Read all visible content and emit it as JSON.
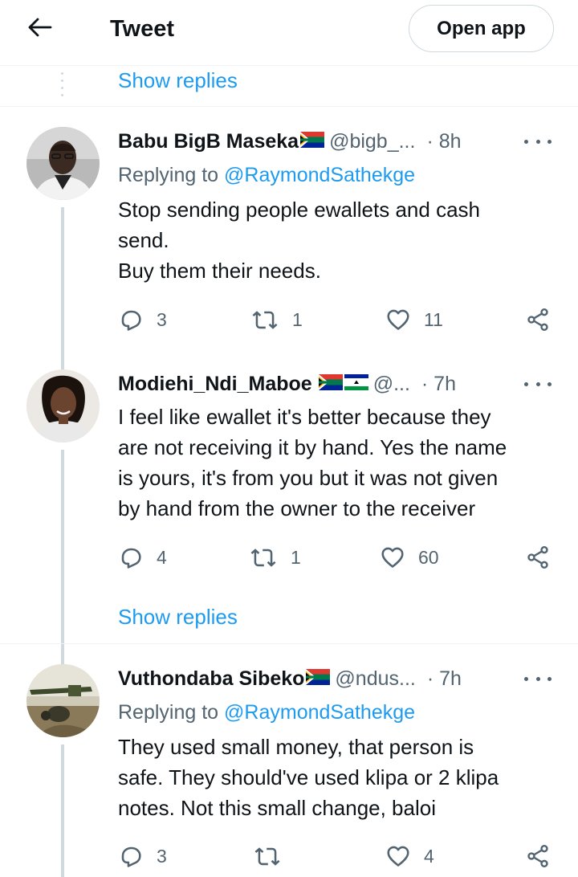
{
  "header": {
    "title": "Tweet",
    "open_app": "Open app"
  },
  "show_replies_label": "Show replies",
  "tweets": [
    {
      "name": "Babu BigB Maseka",
      "handle": "@bigb_...",
      "time": "· 8h",
      "replying_prefix": "Replying to ",
      "replying_to": "@RaymondSathekge",
      "lines": [
        "Stop sending people ewallets and cash",
        "send.",
        "Buy them their needs."
      ],
      "replies": "3",
      "retweets": "1",
      "likes": "11"
    },
    {
      "name": "Modiehi_Ndi_Maboe",
      "handle": "@...",
      "time": "· 7h",
      "lines": [
        "I feel like ewallet it's better because they",
        "are not receiving it by hand. Yes the name",
        "is yours, it's from you but it was not given",
        "by hand from the owner to the receiver"
      ],
      "replies": "4",
      "retweets": "1",
      "likes": "60"
    },
    {
      "name": "Vuthondaba Sibeko",
      "handle": "@ndus...",
      "time": "· 7h",
      "replying_prefix": "Replying to ",
      "replying_to": "@RaymondSathekge",
      "lines": [
        "They used small money, that person is",
        "safe. They should've used klipa or 2 klipa",
        "notes. Not this small change, baloi"
      ],
      "replies": "3",
      "retweets": "",
      "likes": "4"
    }
  ],
  "icons": {
    "back": "arrow-left-icon",
    "reply": "reply-icon",
    "retweet": "retweet-icon",
    "like": "heart-icon",
    "share": "share-icon",
    "more": "more-icon"
  },
  "colors": {
    "link": "#1d9bf0",
    "secondary": "#536471",
    "thread": "#cfd9de"
  }
}
